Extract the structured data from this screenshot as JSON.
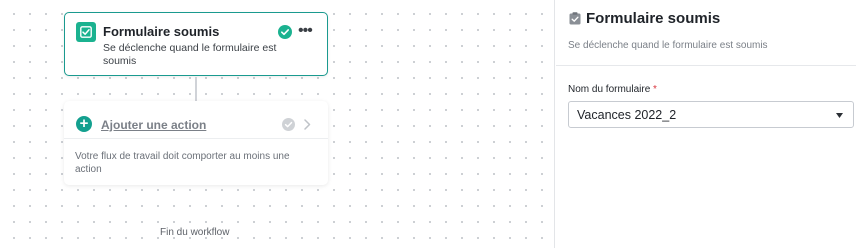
{
  "canvas": {
    "trigger": {
      "title": "Formulaire soumis",
      "description": "Se déclenche quand le formulaire est soumis",
      "icon": "checkbox-form-icon",
      "status_icon": "check-circle-icon",
      "menu_label": "•••"
    },
    "action": {
      "label": "Ajouter une action",
      "warning": "Votre flux de travail doit comporter au moins une action",
      "plus": "+"
    },
    "end_label": "Fin du workflow"
  },
  "panel": {
    "title": "Formulaire soumis",
    "subtitle": "Se déclenche quand le formulaire est soumis",
    "field_label": "Nom du formulaire",
    "required_marker": "*",
    "selected_value": "Vacances 2022_2"
  },
  "colors": {
    "accent": "#1a9a8f",
    "icon_green": "#1bb290",
    "required": "#d9363e"
  }
}
